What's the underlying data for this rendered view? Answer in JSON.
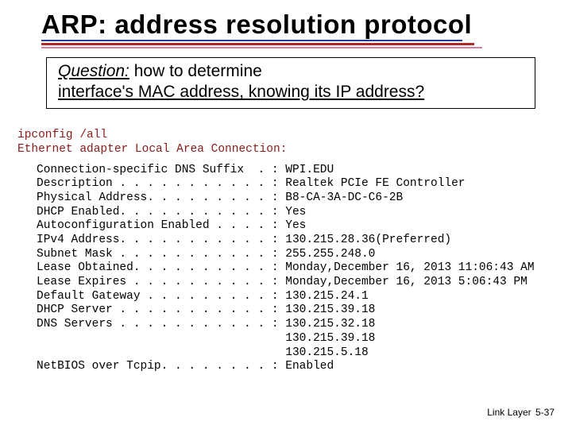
{
  "title": "ARP: address resolution protocol",
  "question": {
    "label": "Question:",
    "rest_plain": " how to determine",
    "rest_underlined": "interface's MAC address, knowing its IP address?"
  },
  "terminal": {
    "header_line1": "ipconfig /all",
    "header_line2": "Ethernet adapter Local Area Connection:",
    "rows": [
      {
        "label": "Connection-specific DNS Suffix  .",
        "value": "WPI.EDU"
      },
      {
        "label": "Description . . . . . . . . . . .",
        "value": "Realtek PCIe FE Controller"
      },
      {
        "label": "Physical Address. . . . . . . . .",
        "value": "B8-CA-3A-DC-C6-2B"
      },
      {
        "label": "DHCP Enabled. . . . . . . . . . .",
        "value": "Yes"
      },
      {
        "label": "Autoconfiguration Enabled . . . .",
        "value": "Yes"
      },
      {
        "label": "IPv4 Address. . . . . . . . . . .",
        "value": "130.215.28.36(Preferred)"
      },
      {
        "label": "Subnet Mask . . . . . . . . . . .",
        "value": "255.255.248.0"
      },
      {
        "label": "Lease Obtained. . . . . . . . . .",
        "value": "Monday,December 16, 2013 11:06:43 AM"
      },
      {
        "label": "Lease Expires . . . . . . . . . .",
        "value": "Monday,December 16, 2013 5:06:43 PM"
      },
      {
        "label": "Default Gateway . . . . . . . . .",
        "value": "130.215.24.1"
      },
      {
        "label": "DHCP Server . . . . . . . . . . .",
        "value": "130.215.39.18"
      },
      {
        "label": "DNS Servers . . . . . . . . . . .",
        "value": "130.215.32.18"
      }
    ],
    "dns_extra": [
      "130.215.39.18",
      "130.215.5.18"
    ],
    "netbios": {
      "label": "NetBIOS over Tcpip. . . . . . . .",
      "value": "Enabled"
    }
  },
  "footer": {
    "section": "Link Layer",
    "page": "5-37"
  }
}
